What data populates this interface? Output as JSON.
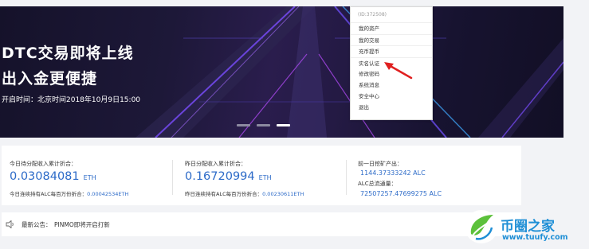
{
  "banner": {
    "title_line1": "DTC交易即将上线",
    "title_line2": "出入金更便捷",
    "subtitle": "开启时间：北京时间2018年10月9日15:00",
    "carousel_dots": 3,
    "active_dot": 3
  },
  "account_menu": {
    "user_id": "(ID:372508)",
    "items": [
      "我的资产",
      "我的交易",
      "充币提币",
      "实名认证",
      "修改密码",
      "系统消息",
      "安全中心",
      "退出"
    ],
    "highlighted": "实名认证"
  },
  "stats": {
    "col1": {
      "label": "今日待分配收入累计折合：",
      "value": "0.03084081",
      "unit": "ETH",
      "sub_label": "今日连续持有ALC每百万份折合：",
      "sub_value": "0.00042534ETH"
    },
    "col2": {
      "label": "昨日分配收入累计折合：",
      "value": "0.16720994",
      "unit": "ETH",
      "sub_label": "昨日连续持有ALC每百万份折合：",
      "sub_value": "0.00230611ETH"
    },
    "col3": {
      "label1": "前一日挖矿产出：",
      "value1": "1144.37333242 ALC",
      "label2": "ALC总流通量：",
      "value2": "72507257.47699275 ALC"
    }
  },
  "notice": {
    "label": "最新公告：",
    "text": "PINMO即将开启打新"
  },
  "watermark": {
    "title": "币圈之家",
    "url": "www.tuufy.com"
  },
  "colors": {
    "accent_blue": "#2d6bc8",
    "arrow_red": "#e02020",
    "watermark_blue": "#1f8fd6",
    "watermark_green": "#5cc13b"
  }
}
